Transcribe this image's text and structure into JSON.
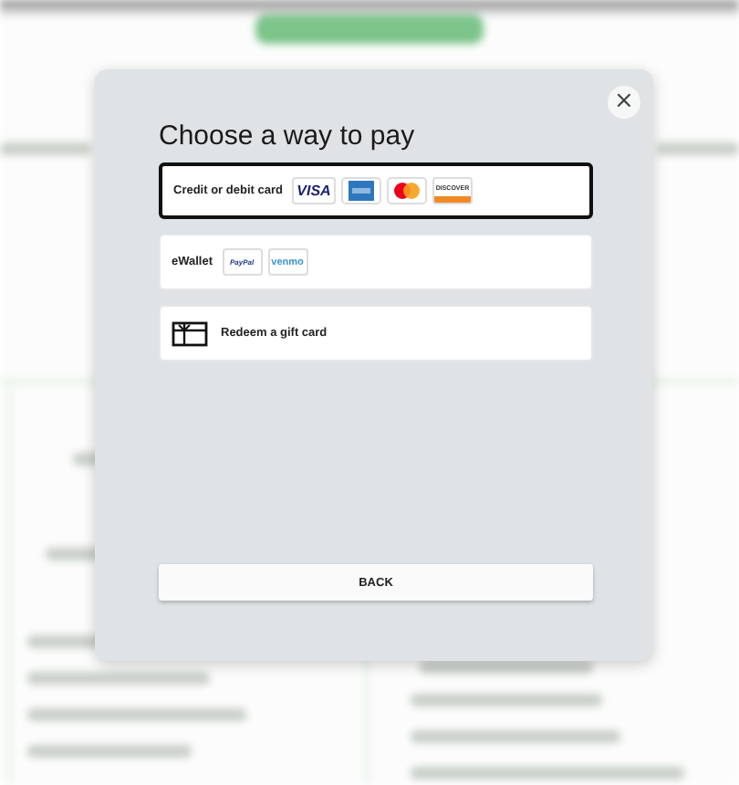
{
  "dialog": {
    "title": "Choose a way to pay",
    "close_label": "×"
  },
  "payment_options": [
    {
      "kind": "card",
      "label": "Credit or debit card",
      "selected": true,
      "logos": [
        {
          "kind": "visa",
          "text": "VISA"
        },
        {
          "kind": "amex"
        },
        {
          "kind": "mastercard"
        },
        {
          "kind": "discover",
          "text": "DISCOVER"
        }
      ]
    },
    {
      "kind": "wallet",
      "label": "eWallet",
      "selected": false,
      "logos": [
        {
          "kind": "paypal",
          "text": "PayPal"
        },
        {
          "kind": "venmo",
          "text": "venmo"
        }
      ]
    },
    {
      "kind": "gift",
      "label": "Redeem a gift card",
      "selected": false
    }
  ],
  "back_button": "BACK"
}
